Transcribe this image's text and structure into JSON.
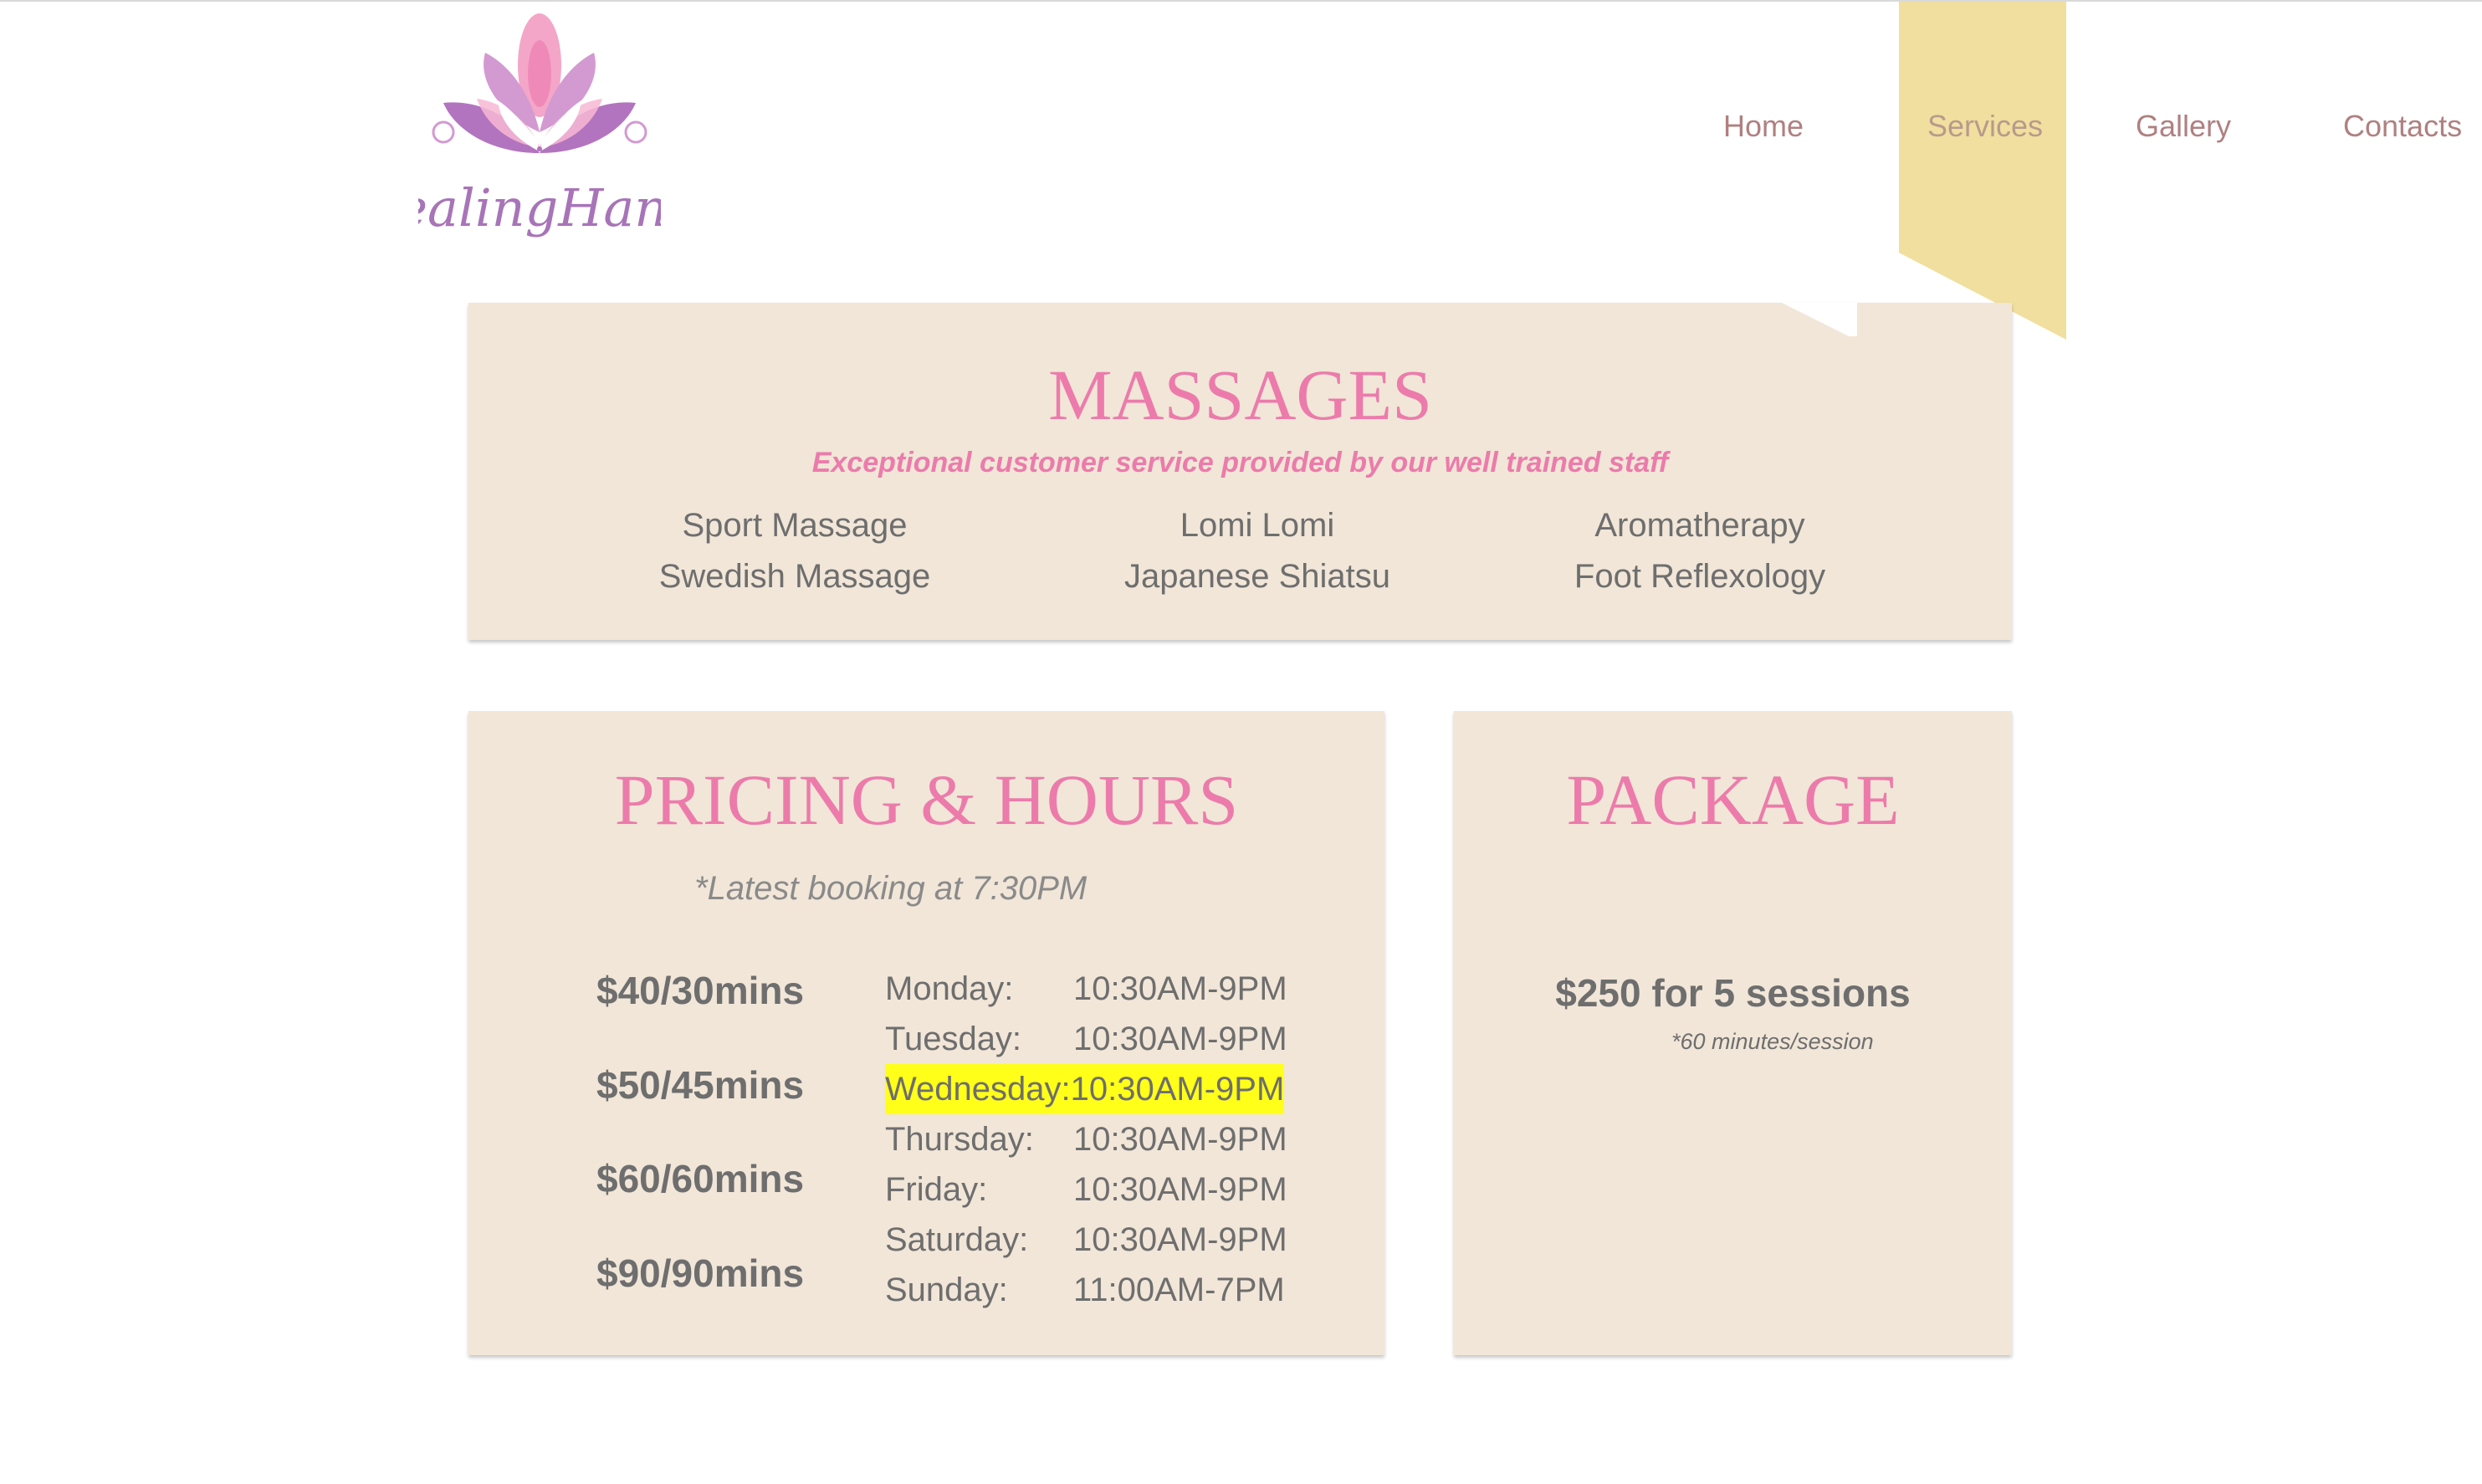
{
  "brand": {
    "name": "HealingHands"
  },
  "nav": {
    "items": [
      {
        "label": "Home"
      },
      {
        "label": "Services"
      },
      {
        "label": "Gallery"
      },
      {
        "label": "Contacts"
      }
    ],
    "active": "Services",
    "active_color": "#f0df9e"
  },
  "massages": {
    "title": "MASSAGES",
    "subtitle": "Exceptional customer service provided by our well trained staff",
    "services": [
      [
        "Sport Massage",
        "Swedish Massage"
      ],
      [
        "Lomi Lomi",
        "Japanese Shiatsu"
      ],
      [
        "Aromatherapy",
        "Foot Reflexology"
      ]
    ]
  },
  "pricing": {
    "title": "PRICING & HOURS",
    "booking_note": "*Latest booking at 7:30PM",
    "prices": [
      "$40/30mins",
      "$50/45mins",
      "$60/60mins",
      "$90/90mins"
    ],
    "hours": [
      {
        "day": "Monday:",
        "time": "10:30AM-9PM"
      },
      {
        "day": "Tuesday:",
        "time": "10:30AM-9PM"
      },
      {
        "day": "Wednesday:",
        "time": "10:30AM-9PM",
        "highlighted": true
      },
      {
        "day": "Thursday:",
        "time": "10:30AM-9PM"
      },
      {
        "day": "Friday:",
        "time": "10:30AM-9PM"
      },
      {
        "day": "Saturday:",
        "time": "10:30AM-9PM"
      },
      {
        "day": "Sunday:",
        "time": "11:00AM-7PM"
      }
    ]
  },
  "package": {
    "title": "PACKAGE",
    "price": "$250 for 5 sessions",
    "note": "*60 minutes/session"
  },
  "colors": {
    "card_bg": "#f1e6d8",
    "accent_pink": "#ec7bab",
    "nav_text": "#b08080",
    "highlight": "#ffff1a"
  }
}
